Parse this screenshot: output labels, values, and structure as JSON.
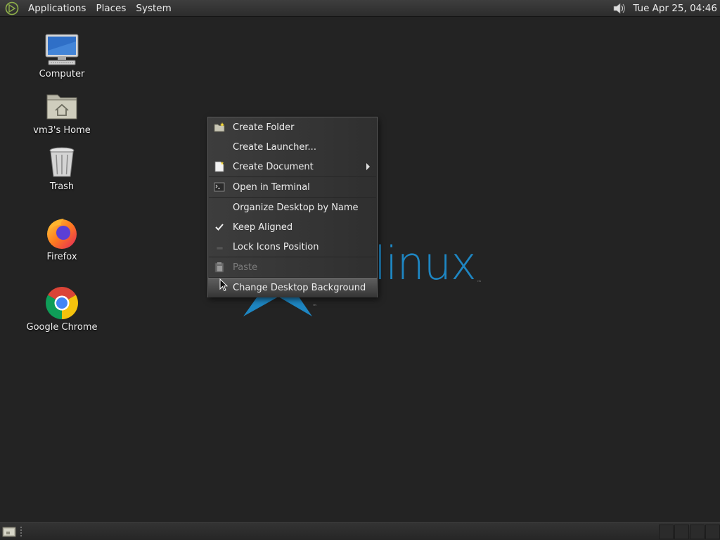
{
  "top_panel": {
    "menus": [
      "Applications",
      "Places",
      "System"
    ],
    "clock": "Tue Apr 25, 04:46",
    "icons": {
      "logo": "distro-logo-icon",
      "volume": "volume-icon"
    }
  },
  "desktop": {
    "icons": [
      {
        "label": "Computer",
        "icon": "computer-icon"
      },
      {
        "label": "vm3's Home",
        "icon": "home-folder-icon"
      },
      {
        "label": "Trash",
        "icon": "trash-icon"
      },
      {
        "label": "Firefox",
        "icon": "firefox-icon"
      },
      {
        "label": "Google Chrome",
        "icon": "chrome-icon"
      }
    ],
    "wallpaper": {
      "text": "linux",
      "tm": "™",
      "color": "#1e86c2"
    }
  },
  "context_menu": {
    "items": [
      {
        "label": "Create Folder",
        "icon": "new-folder-icon"
      },
      {
        "label": "Create Launcher..."
      },
      {
        "label": "Create Document",
        "icon": "new-document-icon",
        "submenu": true
      },
      {
        "label": "Open in Terminal",
        "icon": "terminal-icon"
      },
      {
        "label": "Organize Desktop by Name"
      },
      {
        "label": "Keep Aligned",
        "checked": true
      },
      {
        "label": "Lock Icons Position",
        "checked": false
      },
      {
        "label": "Paste",
        "icon": "paste-icon",
        "disabled": true
      },
      {
        "label": "Change Desktop Background",
        "highlighted": true
      }
    ]
  },
  "bottom_panel": {
    "icons": {
      "show_desktop": "show-desktop-icon"
    },
    "workspaces": 4,
    "active_workspace": 1
  },
  "colors": {
    "desktop_bg": "#232323",
    "panel_bg": "#333333",
    "accent_blue": "#1e86c2"
  }
}
